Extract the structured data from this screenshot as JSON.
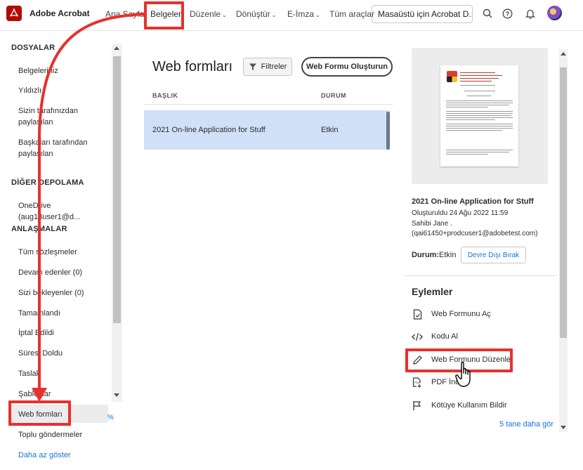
{
  "app": {
    "name": "Adobe Acrobat"
  },
  "nav": {
    "items": [
      {
        "label": "Ana Sayfa",
        "chevron": false
      },
      {
        "label": "Belgeler",
        "chevron": false
      },
      {
        "label": "Düzenle",
        "chevron": true
      },
      {
        "label": "Dönüştür",
        "chevron": true
      },
      {
        "label": "E-İmza",
        "chevron": true
      },
      {
        "label": "Tüm araçlar",
        "chevron": false
      }
    ],
    "desktop_button": "Masaüstü için Acrobat D..."
  },
  "sidebar": {
    "files_title": "DOSYALAR",
    "files": [
      "Belgeleriniz",
      "Yıldızlı",
      "Sizin tarafınızdan paylaşılan",
      "Başkaları tarafından paylaşılan"
    ],
    "storage_title": "DİĞER DEPOLAMA",
    "storage": [
      "OneDrive (aug18user1@d..."
    ],
    "agreements_title": "ANLAŞMALAR",
    "agreements": [
      "Tüm sözleşmeler",
      "Devam edenler (0)",
      "Sizi bekleyenler (0)",
      "Tamamlandı",
      "İptal Edildi",
      "Süresi Doldu",
      "Taslak",
      "Şablonlar",
      "Web formları",
      "Toplu göndermeler"
    ],
    "show_less": "Daha az göster",
    "percent_fragment": "%"
  },
  "main": {
    "title": "Web formları",
    "filter_label": "Filtreler",
    "create_label": "Web Formu Oluşturun",
    "col_title": "BAŞLIK",
    "col_status": "DURUM",
    "rows": [
      {
        "title": "2021 On-line Application for Stuff",
        "status": "Etkin"
      }
    ]
  },
  "details": {
    "title": "2021 On-line Application for Stuff",
    "created": "Oluşturuldu 24 Ağu 2022 11:59",
    "owner": "Sahibi Jane .",
    "email": "(qai61450+prodcuser1@adobetest.com)",
    "status_label": "Durum:",
    "status_value": "Etkin",
    "disable_button": "Devre Dışı Bırak",
    "actions_title": "Eylemler",
    "actions": [
      {
        "label": "Web Formunu Aç",
        "icon": "open-doc-icon"
      },
      {
        "label": "Kodu Al",
        "icon": "code-icon"
      },
      {
        "label": "Web Formunu Düzenle",
        "icon": "pencil-icon"
      },
      {
        "label": "PDF İndir",
        "icon": "pdf-download-icon"
      },
      {
        "label": "Kötüye Kullanım Bildir",
        "icon": "flag-icon"
      }
    ],
    "more_link": "5 tane daha gör"
  },
  "colors": {
    "accent": "#1473e6",
    "highlight": "#e8302e",
    "selected_row": "#cfe0f7",
    "brand": "#b30b00"
  }
}
